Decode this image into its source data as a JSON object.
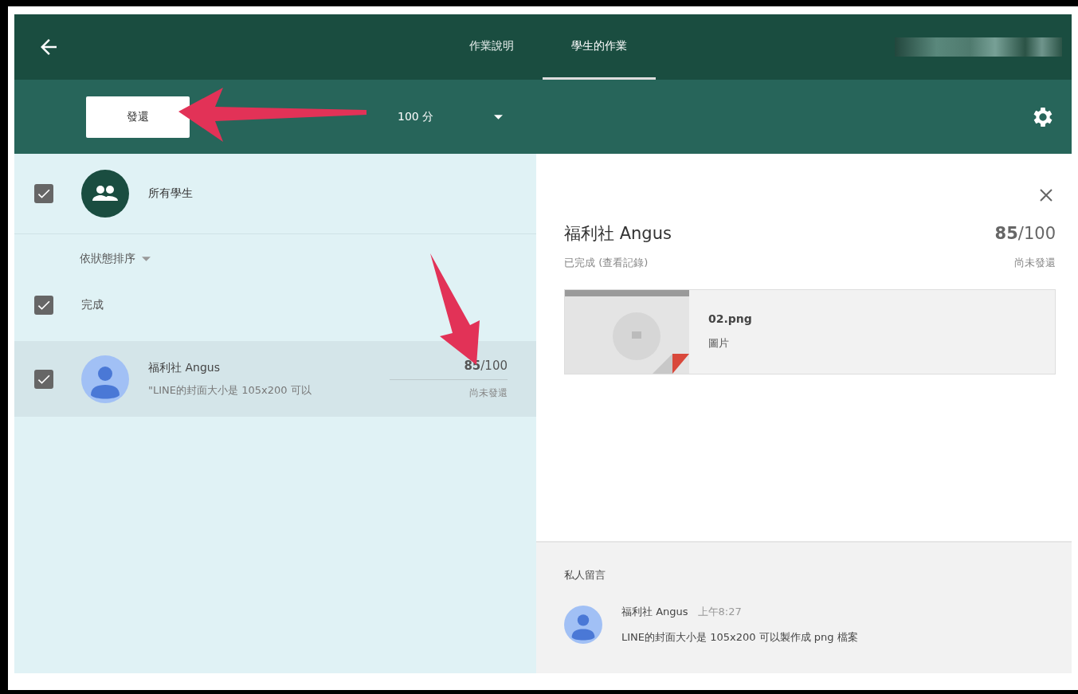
{
  "header": {
    "tabs": [
      {
        "label": "作業說明",
        "selected": false
      },
      {
        "label": "學生的作業",
        "selected": true
      }
    ]
  },
  "toolbar": {
    "return_button": "發還",
    "points": "100 分"
  },
  "student_list": {
    "all_students": {
      "label": "所有學生",
      "checked": true
    },
    "sort": "依狀態排序",
    "groups": [
      {
        "label": "完成",
        "checked": true,
        "students": [
          {
            "name": "福利社 Angus",
            "preview": "\"LINE的封面大小是 105x200 可以",
            "grade": "**85**/100",
            "status": "尚未發還",
            "checked": true,
            "selected": true
          }
        ]
      }
    ]
  },
  "detail": {
    "name": "福利社 Angus",
    "grade": "**85**/100",
    "state": "已完成 (查看記錄)",
    "status": "尚未發還",
    "attachment": {
      "file": "02.png",
      "type": "圖片"
    },
    "private_comments": {
      "title": "私人留言",
      "comments": [
        {
          "author": "福利社 Angus",
          "time": "上午8:27",
          "text": "LINE的封面大小是 105x200 可以製作成 png 檔案"
        }
      ]
    }
  }
}
